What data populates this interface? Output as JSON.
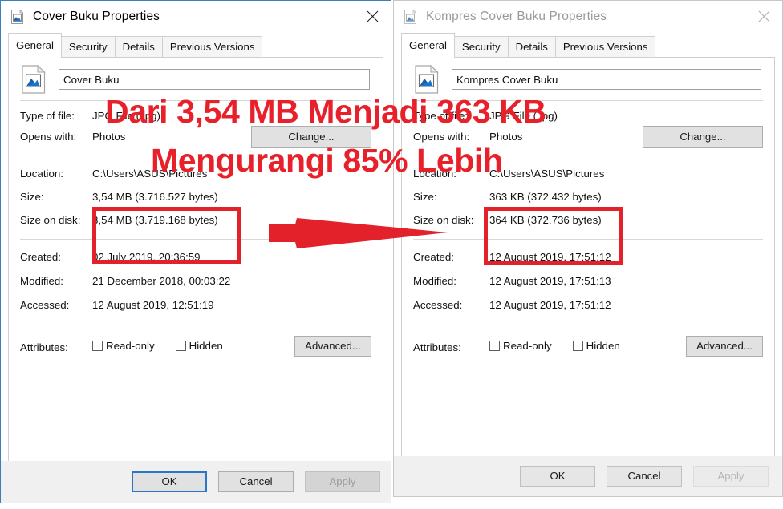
{
  "windows": [
    {
      "state": "active",
      "title": "Cover Buku Properties",
      "icon": "image-file-icon",
      "close_label": "close-icon",
      "tabs": [
        {
          "label": "General",
          "selected": true
        },
        {
          "label": "Security",
          "selected": false
        },
        {
          "label": "Details",
          "selected": false
        },
        {
          "label": "Previous Versions",
          "selected": false
        }
      ],
      "filename": "Cover Buku",
      "fields": {
        "type_of_file_label": "Type of file:",
        "type_of_file_value": "JPG File (.jpg)",
        "opens_with_label": "Opens with:",
        "opens_with_value": "Photos",
        "change_button": "Change...",
        "location_label": "Location:",
        "location_value": "C:\\Users\\ASUS\\Pictures",
        "size_label": "Size:",
        "size_value": "3,54 MB (3.716.527 bytes)",
        "size_on_disk_label": "Size on disk:",
        "size_on_disk_value": "3,54 MB (3.719.168 bytes)",
        "created_label": "Created:",
        "created_value": "02 July 2019, 20:36:59",
        "modified_label": "Modified:",
        "modified_value": "21 December 2018, 00:03:22",
        "accessed_label": "Accessed:",
        "accessed_value": "12 August 2019, 12:51:19",
        "attributes_label": "Attributes:",
        "readonly_label": "Read-only",
        "hidden_label": "Hidden",
        "advanced_button": "Advanced..."
      },
      "footer": {
        "ok": "OK",
        "cancel": "Cancel",
        "apply": "Apply"
      }
    },
    {
      "state": "inactive",
      "title": "Kompres Cover Buku Properties",
      "icon": "image-file-icon",
      "close_label": "close-icon",
      "tabs": [
        {
          "label": "General",
          "selected": true
        },
        {
          "label": "Security",
          "selected": false
        },
        {
          "label": "Details",
          "selected": false
        },
        {
          "label": "Previous Versions",
          "selected": false
        }
      ],
      "filename": "Kompres Cover Buku",
      "fields": {
        "type_of_file_label": "Type of file:",
        "type_of_file_value": "JPG File (.jpg)",
        "opens_with_label": "Opens with:",
        "opens_with_value": "Photos",
        "change_button": "Change...",
        "location_label": "Location:",
        "location_value": "C:\\Users\\ASUS\\Pictures",
        "size_label": "Size:",
        "size_value": "363 KB (372.432 bytes)",
        "size_on_disk_label": "Size on disk:",
        "size_on_disk_value": "364 KB (372.736 bytes)",
        "created_label": "Created:",
        "created_value": "12 August 2019, 17:51:12",
        "modified_label": "Modified:",
        "modified_value": "12 August 2019, 17:51:13",
        "accessed_label": "Accessed:",
        "accessed_value": "12 August 2019, 17:51:12",
        "attributes_label": "Attributes:",
        "readonly_label": "Read-only",
        "hidden_label": "Hidden",
        "advanced_button": "Advanced..."
      },
      "footer": {
        "ok": "OK",
        "cancel": "Cancel",
        "apply": "Apply"
      }
    }
  ],
  "annotation": {
    "line1": "Dari 3,54 MB Menjadi 363 KB",
    "line2": "Mengurangi 85% Lebih",
    "color": "#e3212a",
    "arrow": "right-arrow",
    "highlight_left": "size-values-highlight-left",
    "highlight_right": "size-values-highlight-right"
  }
}
